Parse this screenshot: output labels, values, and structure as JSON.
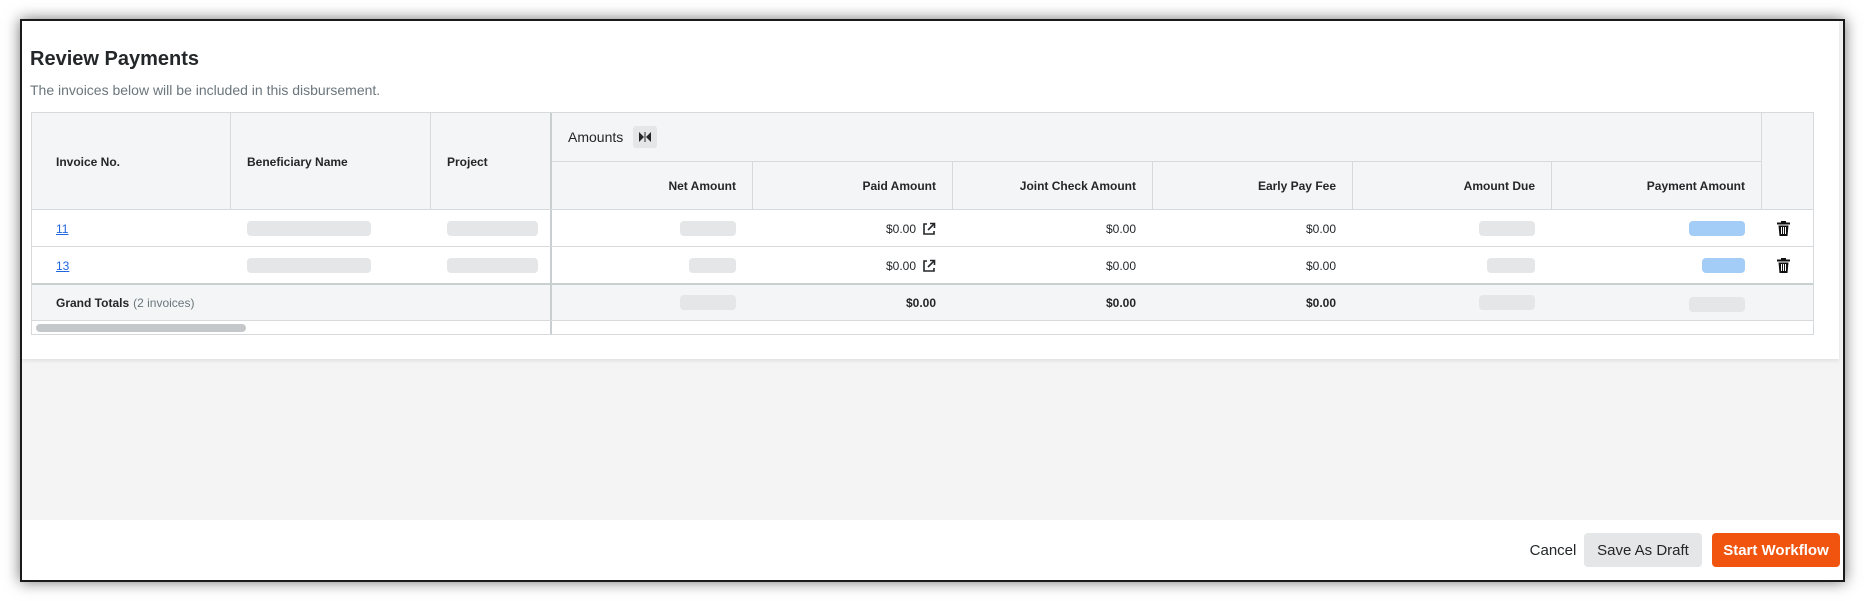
{
  "header": {
    "title": "Review Payments",
    "subtitle": "The invoices below will be included in this disbursement."
  },
  "table": {
    "columns": {
      "invoice_no": "Invoice No.",
      "beneficiary": "Beneficiary Name",
      "project": "Project",
      "amounts_group": "Amounts",
      "net_amount": "Net Amount",
      "paid_amount": "Paid Amount",
      "joint_check": "Joint Check Amount",
      "early_pay_fee": "Early Pay Fee",
      "amount_due": "Amount Due",
      "payment_amount": "Payment Amount"
    },
    "rows": [
      {
        "invoice_no": "11",
        "paid_amount": "$0.00",
        "joint_check": "$0.00",
        "early_pay_fee": "$0.00"
      },
      {
        "invoice_no": "13",
        "paid_amount": "$0.00",
        "joint_check": "$0.00",
        "early_pay_fee": "$0.00"
      }
    ],
    "totals": {
      "label": "Grand Totals",
      "count": "(2 invoices)",
      "paid_amount": "$0.00",
      "joint_check": "$0.00",
      "early_pay_fee": "$0.00"
    }
  },
  "footer": {
    "cancel_label": "Cancel",
    "draft_label": "Save As Draft",
    "start_label": "Start Workflow"
  },
  "colors": {
    "accent": "#f0540e",
    "link": "#2066df",
    "skeleton": "#e4e6e7",
    "skeleton_blue": "#a3ccf6"
  },
  "icons": {
    "collapse": "collapse-columns-icon",
    "external": "external-link-icon",
    "delete": "trash-icon"
  }
}
